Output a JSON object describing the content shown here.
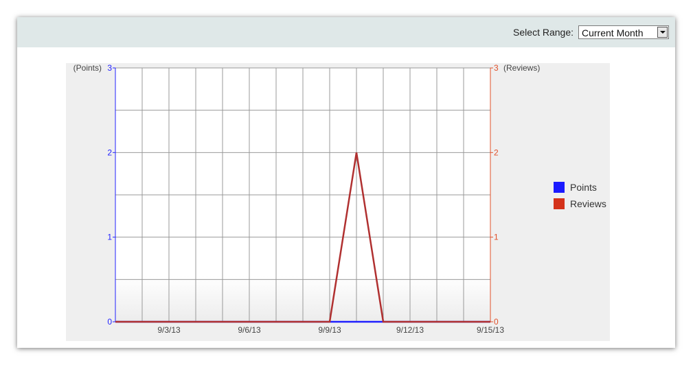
{
  "header": {
    "range_label": "Select Range:",
    "range_value": "Current Month"
  },
  "chart_data": {
    "type": "line",
    "x": [
      "9/1/13",
      "9/2/13",
      "9/3/13",
      "9/4/13",
      "9/5/13",
      "9/6/13",
      "9/7/13",
      "9/8/13",
      "9/9/13",
      "9/10/13",
      "9/11/13",
      "9/12/13",
      "9/13/13",
      "9/14/13",
      "9/15/13"
    ],
    "x_tick_labels": [
      "9/3/13",
      "9/6/13",
      "9/9/13",
      "9/12/13",
      "9/15/13"
    ],
    "series": [
      {
        "name": "Points",
        "axis": "left",
        "color": "#1f1fff",
        "values": [
          0,
          0,
          0,
          0,
          0,
          0,
          0,
          0,
          0,
          0,
          0,
          0,
          0,
          0,
          0
        ]
      },
      {
        "name": "Reviews",
        "axis": "right",
        "color": "#b03030",
        "values": [
          0,
          0,
          0,
          0,
          0,
          0,
          0,
          0,
          0,
          2,
          0,
          0,
          0,
          0,
          0
        ]
      }
    ],
    "left_axis": {
      "label": "(Points)",
      "ylim": [
        0,
        3
      ],
      "ticks": [
        0,
        1,
        2,
        3
      ],
      "color": "#2222ff"
    },
    "right_axis": {
      "label": "(Reviews)",
      "ylim": [
        0,
        3
      ],
      "ticks": [
        0,
        1,
        2,
        3
      ],
      "color": "#e0502a"
    },
    "legend": {
      "position": "right",
      "items": [
        {
          "label": "Points",
          "color": "#1a1aff"
        },
        {
          "label": "Reviews",
          "color": "#d4321a"
        }
      ]
    },
    "grid": true
  }
}
